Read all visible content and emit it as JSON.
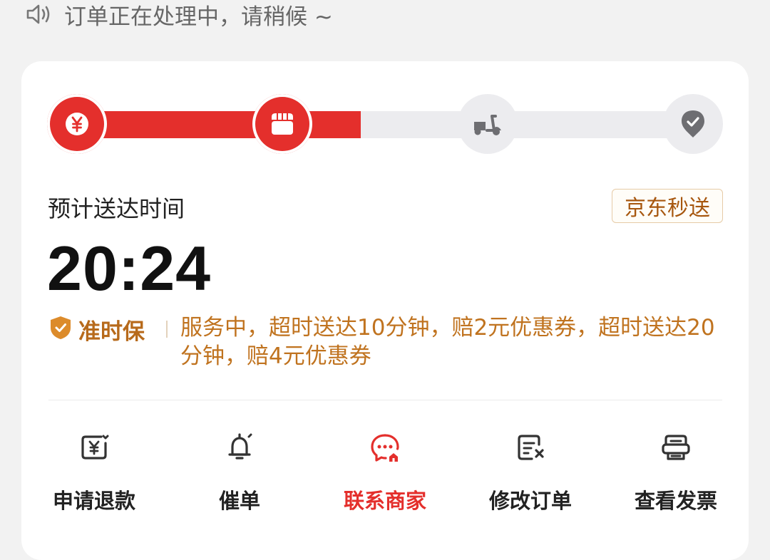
{
  "notice": {
    "icon": "speaker-icon",
    "text": "订单正在处理中，请稍候 ~"
  },
  "progress": {
    "steps": [
      {
        "icon": "yuan-icon",
        "state": "done"
      },
      {
        "icon": "store-icon",
        "state": "current"
      },
      {
        "icon": "scooter-icon",
        "state": "pending"
      },
      {
        "icon": "check-location-icon",
        "state": "pending"
      }
    ],
    "accent": "#e42f2c"
  },
  "eta": {
    "label": "预计送达时间",
    "time": "20:24",
    "brand_tag": "京东秒送"
  },
  "guarantee": {
    "title": "准时保",
    "description": "服务中，超时送达10分钟，赔2元优惠券，超时送达20分钟，赔4元优惠券"
  },
  "actions": [
    {
      "label": "申请退款",
      "icon": "refund-icon"
    },
    {
      "label": "催单",
      "icon": "bell-icon"
    },
    {
      "label": "联系商家",
      "icon": "chat-store-icon",
      "highlight": true
    },
    {
      "label": "修改订单",
      "icon": "edit-order-icon"
    },
    {
      "label": "查看发票",
      "icon": "invoice-icon"
    }
  ]
}
